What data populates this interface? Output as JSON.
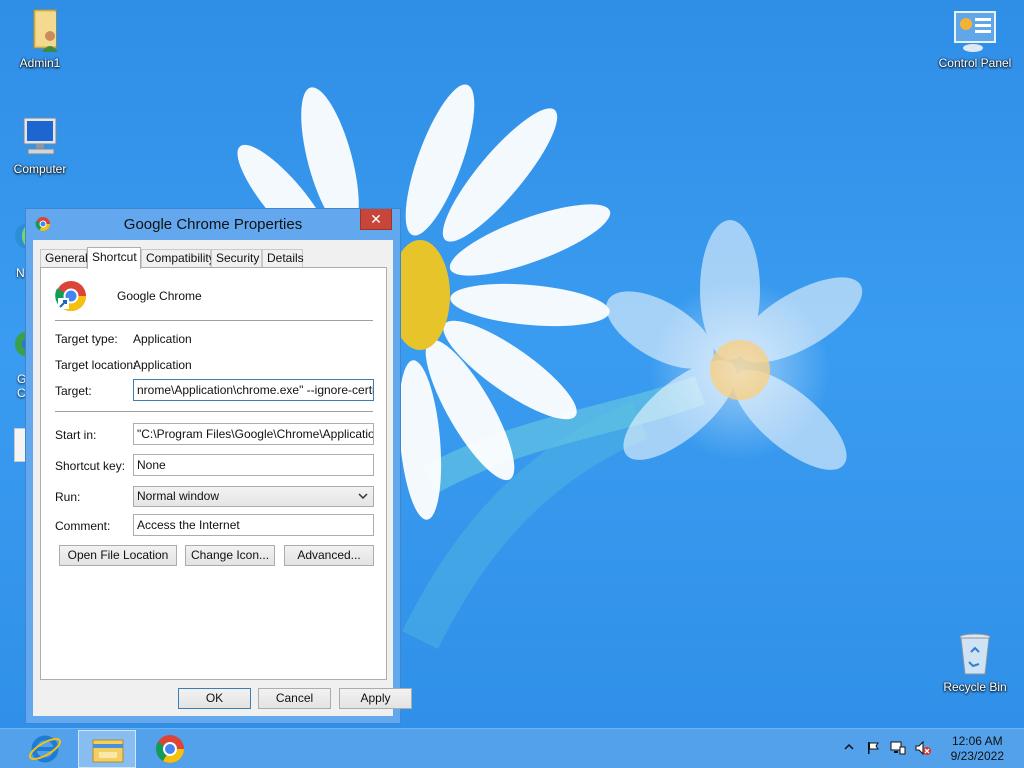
{
  "desktop": {
    "icons": [
      {
        "label": "Admin1"
      },
      {
        "label": "Computer"
      },
      {
        "label": "Control Panel"
      },
      {
        "label": "Recycle Bin"
      }
    ],
    "partial_labels": [
      "N",
      "G",
      "C"
    ]
  },
  "dialog": {
    "title": "Google Chrome Properties",
    "close_glyph": "✕",
    "tabs": [
      "General",
      "Shortcut",
      "Compatibility",
      "Security",
      "Details"
    ],
    "active_tab": "Shortcut",
    "app_name": "Google Chrome",
    "target_type_label": "Target type:",
    "target_type_value": "Application",
    "target_location_label": "Target location:",
    "target_location_value": "Application",
    "target_label": "Target:",
    "target_value": "nrome\\Application\\chrome.exe\" --ignore-certificate",
    "start_in_label": "Start in:",
    "start_in_value": "\"C:\\Program Files\\Google\\Chrome\\Application\"",
    "shortcut_key_label": "Shortcut key:",
    "shortcut_key_value": "None",
    "run_label": "Run:",
    "run_value": "Normal window",
    "comment_label": "Comment:",
    "comment_value": "Access the Internet",
    "open_file_location": "Open File Location",
    "change_icon": "Change Icon...",
    "advanced": "Advanced...",
    "ok": "OK",
    "cancel": "Cancel",
    "apply": "Apply"
  },
  "taskbar": {
    "items": [
      "Internet Explorer",
      "File Explorer",
      "Google Chrome"
    ],
    "active_item": "File Explorer",
    "time": "12:06 AM",
    "date": "9/23/2022"
  },
  "colors": {
    "desktop": "#3a9cf0",
    "title_bar": "#63a8ee",
    "close_button": "#c7463a"
  }
}
